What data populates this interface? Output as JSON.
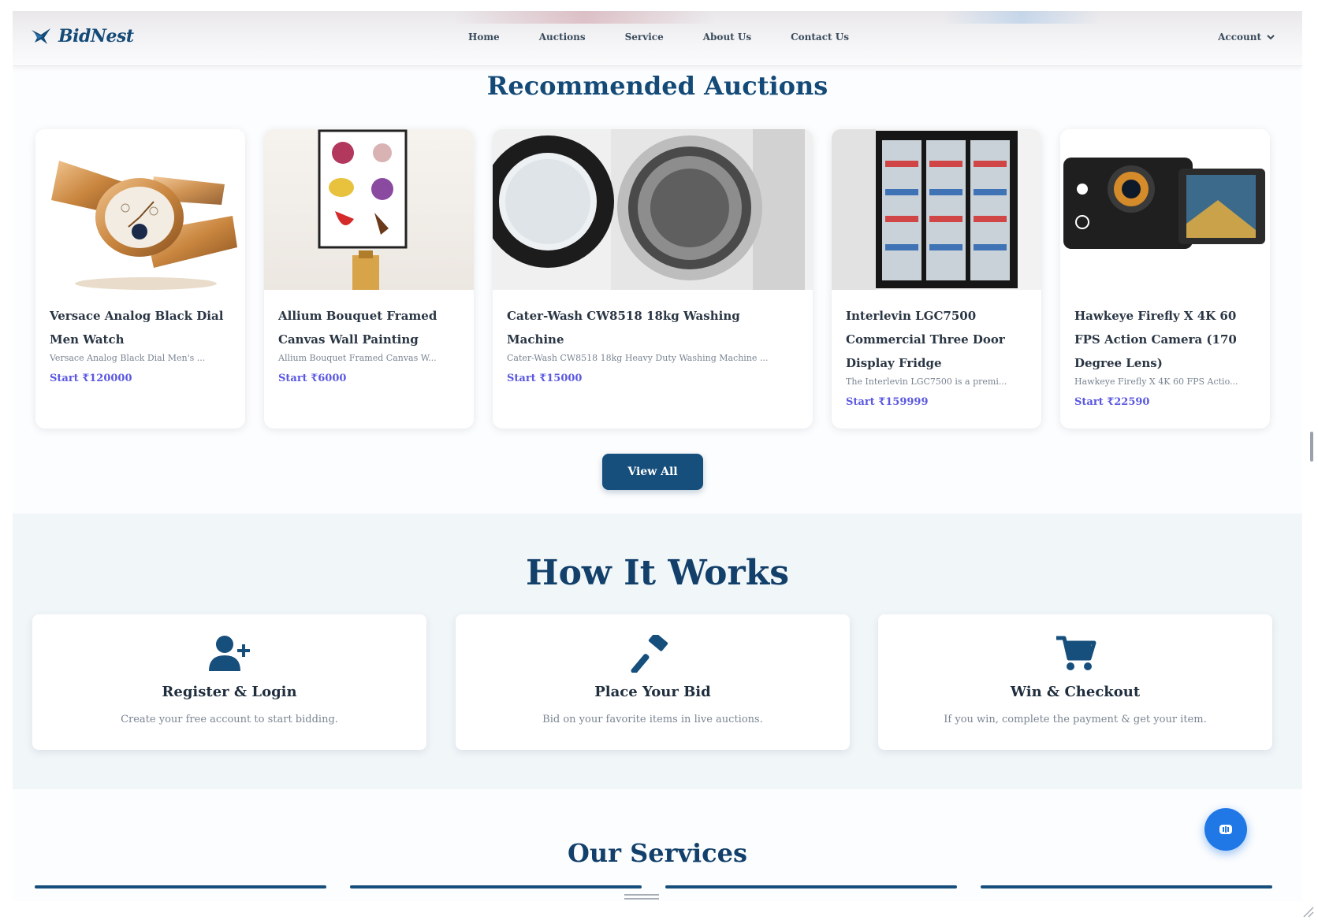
{
  "brand": {
    "name": "BidNest",
    "color": "#144a77",
    "accent": "#5b58e0"
  },
  "nav": {
    "links": [
      "Home",
      "Auctions",
      "Service",
      "About Us",
      "Contact Us"
    ],
    "account": "Account"
  },
  "recommended": {
    "title": "Recommended Auctions",
    "items": [
      {
        "name": "Versace Analog Black Dial Men Watch",
        "desc": "Versace Analog Black Dial Men's ...",
        "price": "Start ₹120000",
        "image": "watch"
      },
      {
        "name": "Allium Bouquet Framed Canvas Wall Painting",
        "desc": "Allium Bouquet Framed Canvas W...",
        "price": "Start ₹6000",
        "image": "painting"
      },
      {
        "name": "Cater-Wash CW8518 18kg Washing Machine",
        "desc": "Cater-Wash CW8518 18kg Heavy Duty Washing Machine ...",
        "price": "Start ₹15000",
        "image": "washing-machine"
      },
      {
        "name": "Interlevin LGC7500 Commercial Three Door Display Fridge",
        "desc": "The Interlevin LGC7500 is a premi...",
        "price": "Start ₹159999",
        "image": "fridge"
      },
      {
        "name": "Hawkeye Firefly X 4K 60 FPS Action Camera (170 Degree Lens)",
        "desc": "Hawkeye Firefly X 4K 60 FPS Actio...",
        "price": "Start ₹22590",
        "image": "action-camera"
      }
    ],
    "view_all": "View All"
  },
  "how": {
    "title": "How It Works",
    "steps": [
      {
        "icon": "user-plus-icon",
        "title": "Register & Login",
        "desc": "Create your free account to start bidding."
      },
      {
        "icon": "gavel-icon",
        "title": "Place Your Bid",
        "desc": "Bid on your favorite items in live auctions."
      },
      {
        "icon": "cart-icon",
        "title": "Win & Checkout",
        "desc": "If you win, complete the payment & get your item."
      }
    ]
  },
  "services": {
    "title": "Our Services"
  },
  "fab": {
    "icon": "chat-bot-icon",
    "color": "#1f78e6"
  }
}
